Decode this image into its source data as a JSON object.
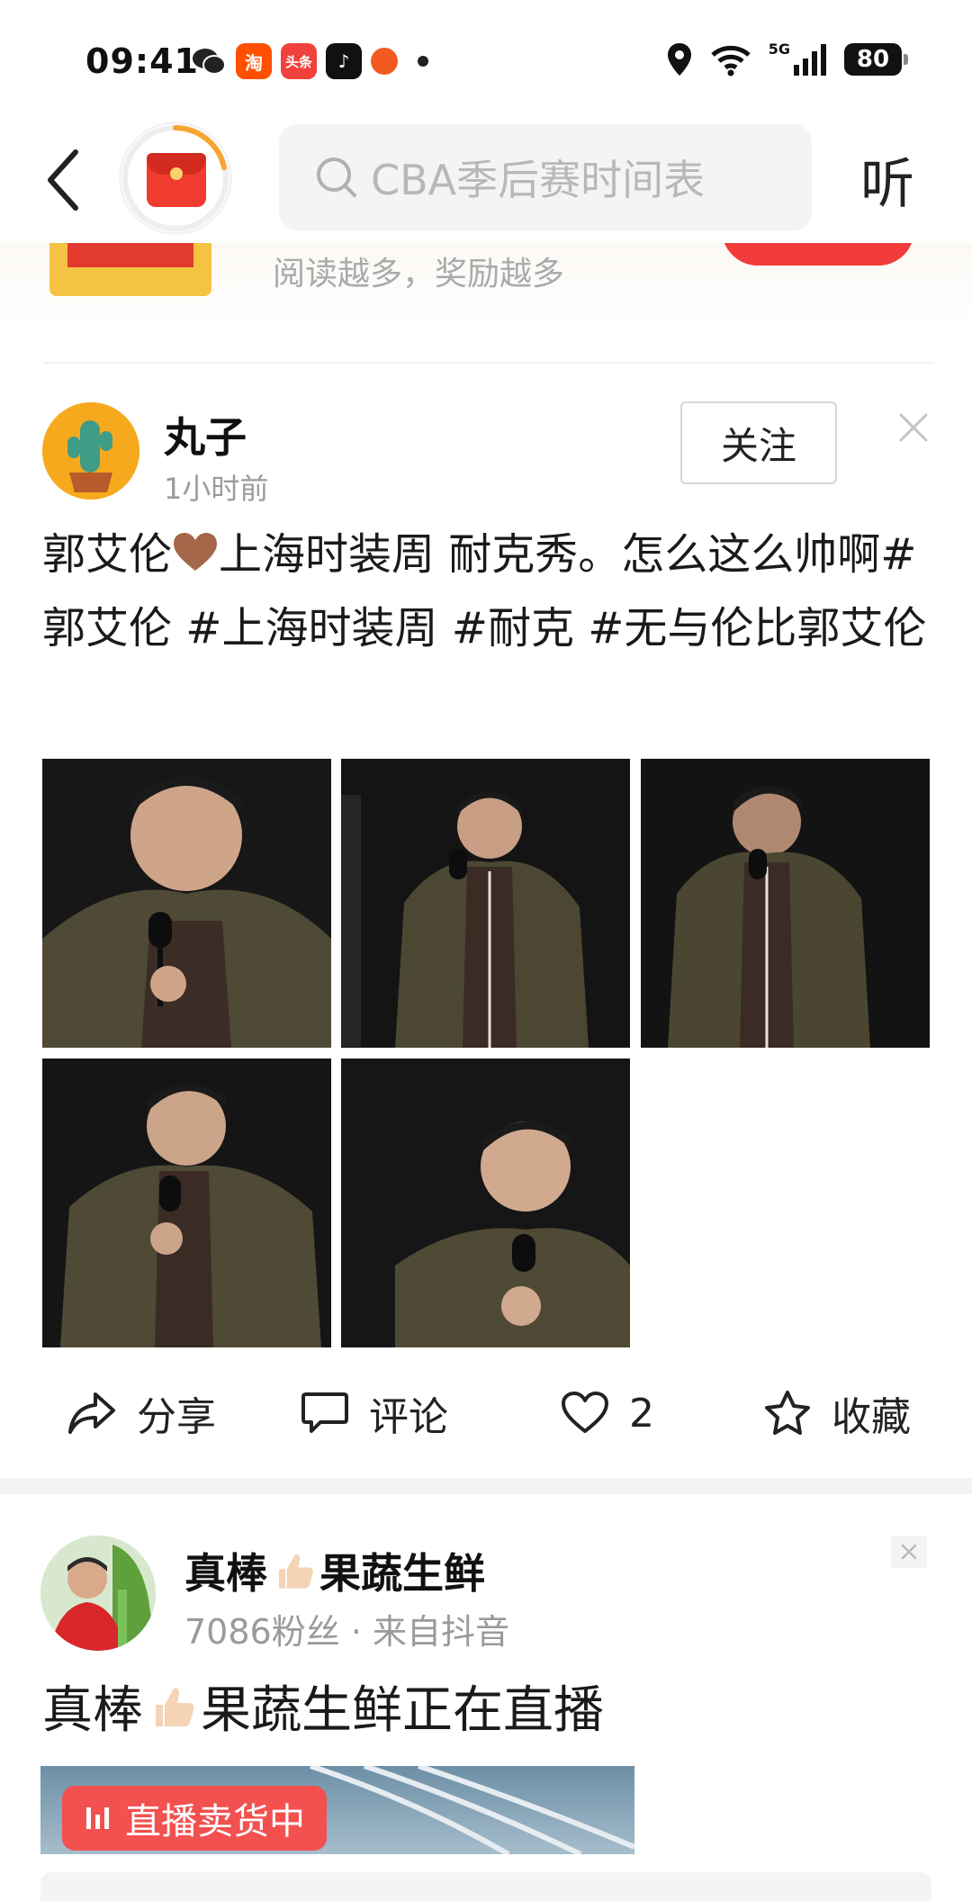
{
  "status_bar": {
    "time": "09:41",
    "apps": [
      {
        "name": "wechat-icon",
        "label": "",
        "color": "#222222"
      },
      {
        "name": "taobao-icon",
        "label": "淘",
        "color": "#ff5000"
      },
      {
        "name": "toutiao-icon",
        "label": "头条",
        "color": "#f0413c"
      },
      {
        "name": "douyin-icon",
        "label": "♪",
        "color": "#111111"
      },
      {
        "name": "app-orange-icon",
        "label": "",
        "color": "#f25a1f"
      }
    ],
    "network": "5G",
    "battery": "80"
  },
  "nav": {
    "search_placeholder": "CBA季后赛时间表",
    "listen_label": "听"
  },
  "reward": {
    "text": "阅读越多，奖励越多"
  },
  "post1": {
    "author": "丸子",
    "time": "1小时前",
    "follow_label": "关注",
    "text_before": "郭艾伦",
    "text_after": "上海时装周  耐克秀。怎么这么帅啊#郭艾伦 #上海时装周 #耐克 #无与伦比郭艾伦",
    "photo_count": 5
  },
  "actions": {
    "share": "分享",
    "comment": "评论",
    "like_count": "2",
    "favorite": "收藏"
  },
  "post2": {
    "author_a": "真棒",
    "author_b": "果蔬生鲜",
    "meta": "7086粉丝 · 来自抖音",
    "text_a": "真棒",
    "text_b": "果蔬生鲜正在直播",
    "live_badge": "直播卖货中"
  },
  "colors": {
    "accent_red": "#f23c3c",
    "live_badge": "#f35050",
    "muted_text": "#9a9a9a"
  }
}
